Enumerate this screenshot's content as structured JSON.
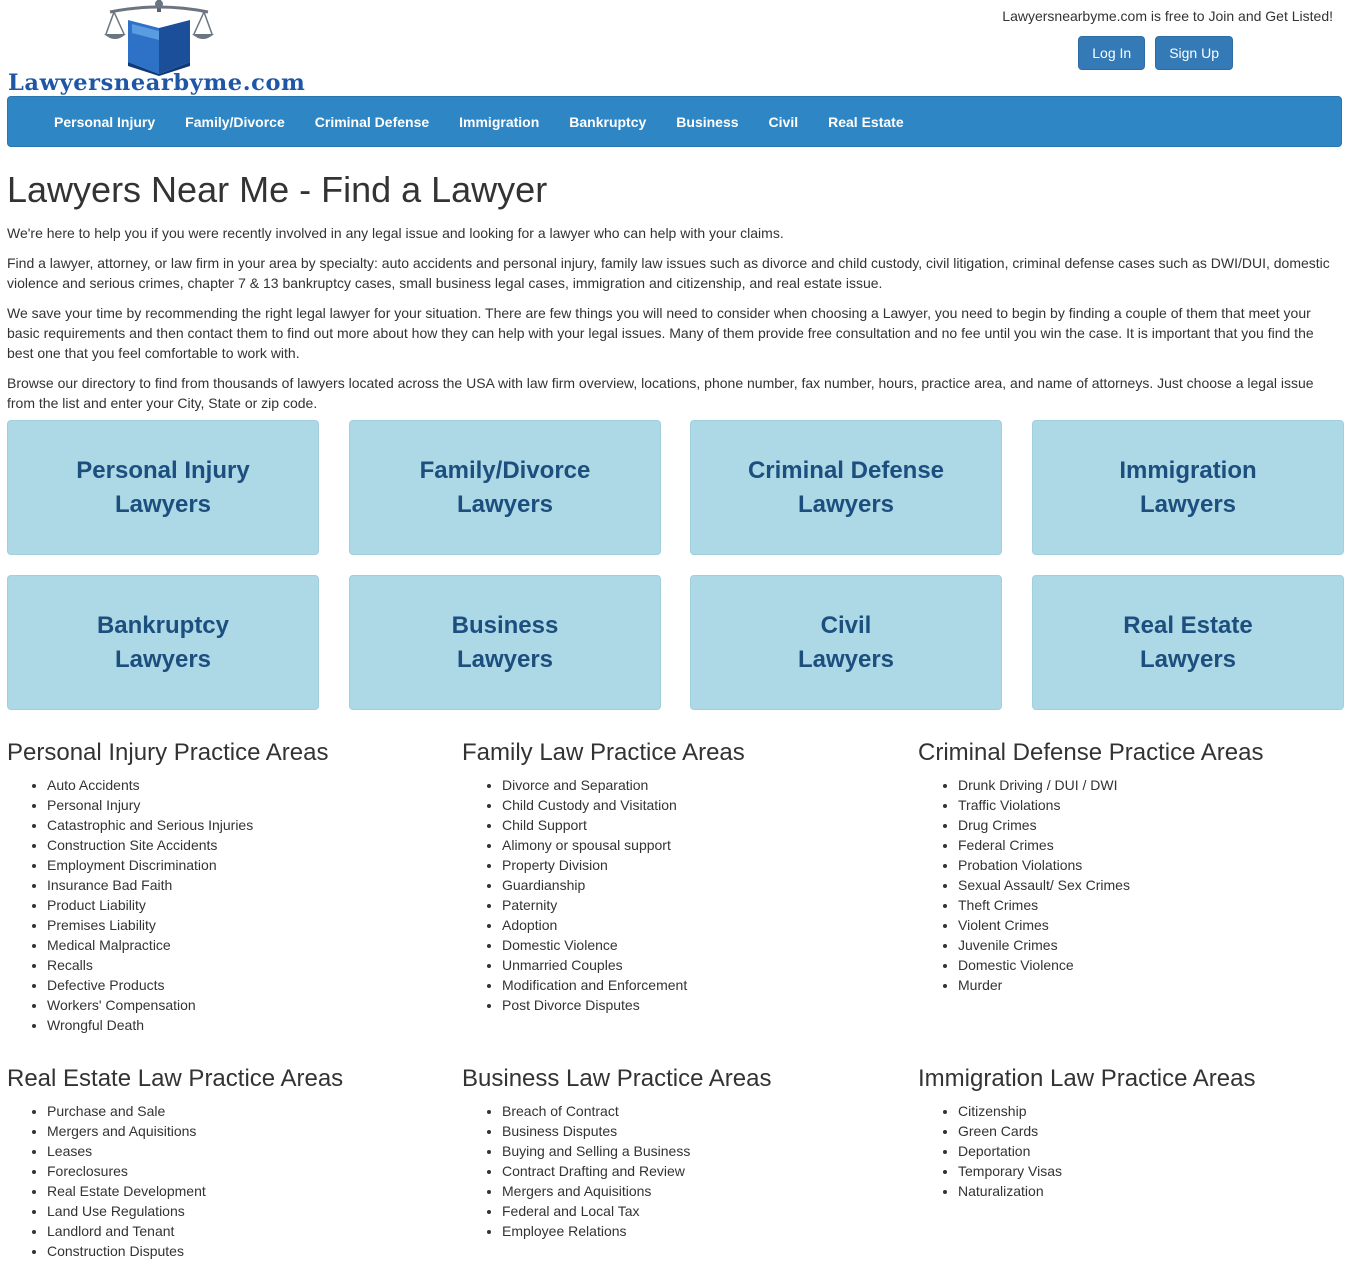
{
  "header": {
    "logo_text": "Lawyersnearbyme.com",
    "tagline": "Lawyersnearbyme.com is free to Join and Get Listed!",
    "login_label": "Log In",
    "signup_label": "Sign Up"
  },
  "nav": {
    "items": [
      "Personal Injury",
      "Family/Divorce",
      "Criminal Defense",
      "Immigration",
      "Bankruptcy",
      "Business",
      "Civil",
      "Real Estate"
    ]
  },
  "main": {
    "title": "Lawyers Near Me - Find a Lawyer",
    "paragraphs": [
      "We're here to help you if you were recently involved in any legal issue and looking for a lawyer who can help with your claims.",
      "Find a lawyer, attorney, or law firm in your area by specialty: auto accidents and personal injury, family law issues such as divorce and child custody, civil litigation, criminal defense cases such as DWI/DUI, domestic violence and serious crimes, chapter 7 & 13 bankruptcy cases, small business legal cases, immigration and citizenship, and real estate issue.",
      "We save your time by recommending the right legal lawyer for your situation. There are few things you will need to consider when choosing a Lawyer, you need to begin by finding a couple of them that meet your basic requirements and then contact them to find out more about how they can help with your legal issues. Many of them provide free consultation and no fee until you win the case. It is important that you find the best one that you feel comfortable to work with.",
      "Browse our directory to find from thousands of lawyers located across the USA with law firm overview, locations, phone number, fax number, hours, practice area, and name of attorneys. Just choose a legal issue from the list and enter your City, State or zip code."
    ]
  },
  "tiles": [
    {
      "line1": "Personal Injury",
      "line2": "Lawyers"
    },
    {
      "line1": "Family/Divorce",
      "line2": "Lawyers"
    },
    {
      "line1": "Criminal Defense",
      "line2": "Lawyers"
    },
    {
      "line1": "Immigration",
      "line2": "Lawyers"
    },
    {
      "line1": "Bankruptcy",
      "line2": "Lawyers"
    },
    {
      "line1": "Business",
      "line2": "Lawyers"
    },
    {
      "line1": "Civil",
      "line2": "Lawyers"
    },
    {
      "line1": "Real Estate",
      "line2": "Lawyers"
    }
  ],
  "practice_areas": [
    {
      "title": "Personal Injury Practice Areas",
      "items": [
        "Auto Accidents",
        "Personal Injury",
        "Catastrophic and Serious Injuries",
        "Construction Site Accidents",
        "Employment Discrimination",
        "Insurance Bad Faith",
        "Product Liability",
        "Premises Liability",
        "Medical Malpractice",
        "Recalls",
        "Defective Products",
        "Workers' Compensation",
        "Wrongful Death"
      ]
    },
    {
      "title": "Family Law Practice Areas",
      "items": [
        "Divorce and Separation",
        "Child Custody and Visitation",
        "Child Support",
        "Alimony or spousal support",
        "Property Division",
        "Guardianship",
        "Paternity",
        "Adoption",
        "Domestic Violence",
        "Unmarried Couples",
        "Modification and Enforcement",
        "Post Divorce Disputes"
      ]
    },
    {
      "title": "Criminal Defense Practice Areas",
      "items": [
        "Drunk Driving / DUI / DWI",
        "Traffic Violations",
        "Drug Crimes",
        "Federal Crimes",
        "Probation Violations",
        "Sexual Assault/ Sex Crimes",
        "Theft Crimes",
        "Violent Crimes",
        "Juvenile Crimes",
        "Domestic Violence",
        "Murder"
      ]
    },
    {
      "title": "Real Estate Law Practice Areas",
      "items": [
        "Purchase and Sale",
        "Mergers and Aquisitions",
        "Leases",
        "Foreclosures",
        "Real Estate Development",
        "Land Use Regulations",
        "Landlord and Tenant",
        "Construction Disputes"
      ]
    },
    {
      "title": "Business Law Practice Areas",
      "items": [
        "Breach of Contract",
        "Business Disputes",
        "Buying and Selling a Business",
        "Contract Drafting and Review",
        "Mergers and Aquisitions",
        "Federal and Local Tax",
        "Employee Relations"
      ]
    },
    {
      "title": "Immigration Law Practice Areas",
      "items": [
        "Citizenship",
        "Green Cards",
        "Deportation",
        "Temporary Visas",
        "Naturalization"
      ]
    }
  ]
}
